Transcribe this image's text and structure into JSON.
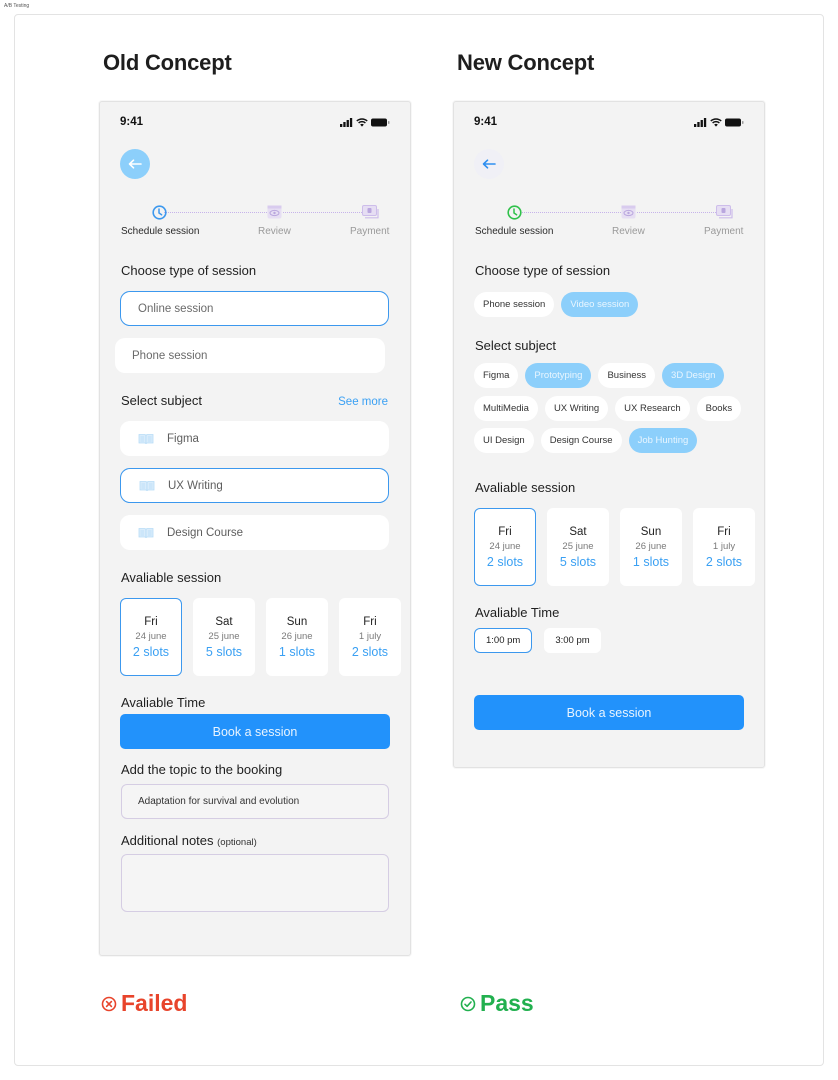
{
  "canvas": {
    "label": "A/B Testing"
  },
  "colors": {
    "accent_blue": "#2292fb",
    "light_blue": "#8ccffb",
    "failed_red": "#e8442b",
    "pass_green": "#22b04f",
    "step_active_old": "#3c98ee",
    "step_active_new": "#2fc14a"
  },
  "old_concept": {
    "title": "Old Concept",
    "status_time": "9:41",
    "back_icon": "arrow-left-icon",
    "stepper": [
      {
        "label": "Schedule session",
        "icon": "clock-icon",
        "active": true
      },
      {
        "label": "Review",
        "icon": "eye-icon",
        "active": false
      },
      {
        "label": "Payment",
        "icon": "cash-icon",
        "active": false
      }
    ],
    "session_type": {
      "title": "Choose type of session",
      "options": [
        {
          "label": "Online session",
          "selected": true
        },
        {
          "label": "Phone session",
          "selected": false
        }
      ]
    },
    "subject": {
      "title": "Select subject",
      "see_more": "See more",
      "options": [
        {
          "label": "Figma",
          "icon": "book-icon",
          "selected": false
        },
        {
          "label": "UX Writing",
          "icon": "book-icon",
          "selected": true
        },
        {
          "label": "Design Course",
          "icon": "book-icon",
          "selected": false
        }
      ]
    },
    "available_session": {
      "title": "Avaliable session",
      "dates": [
        {
          "day": "Fri",
          "date": "24 june",
          "slots": "2 slots",
          "selected": true
        },
        {
          "day": "Sat",
          "date": "25 june",
          "slots": "5 slots",
          "selected": false
        },
        {
          "day": "Sun",
          "date": "26 june",
          "slots": "1 slots",
          "selected": false
        },
        {
          "day": "Fri",
          "date": "1 july",
          "slots": "2 slots",
          "selected": false
        }
      ]
    },
    "available_time": {
      "title": "Avaliable Time"
    },
    "book_button": "Book a session",
    "topic": {
      "title": "Add the topic to the booking",
      "value": "Adaptation for survival and evolution"
    },
    "notes": {
      "title": "Additional notes",
      "optional": "(optional)",
      "value": ""
    },
    "result": {
      "label": "Failed",
      "icon": "x-circle-icon"
    }
  },
  "new_concept": {
    "title": "New Concept",
    "status_time": "9:41",
    "back_icon": "arrow-left-icon",
    "stepper": [
      {
        "label": "Schedule session",
        "icon": "clock-icon",
        "active": true
      },
      {
        "label": "Review",
        "icon": "eye-icon",
        "active": false
      },
      {
        "label": "Payment",
        "icon": "cash-icon",
        "active": false
      }
    ],
    "session_type": {
      "title": "Choose type of session",
      "options": [
        {
          "label": "Phone session",
          "selected": false
        },
        {
          "label": "Video session",
          "selected": true
        }
      ]
    },
    "subject": {
      "title": "Select subject",
      "rows": [
        [
          {
            "label": "Figma",
            "selected": false
          },
          {
            "label": "Prototyping",
            "selected": true
          },
          {
            "label": "Business",
            "selected": false
          },
          {
            "label": "3D Design",
            "selected": true
          }
        ],
        [
          {
            "label": "MultiMedia",
            "selected": false
          },
          {
            "label": "UX Writing",
            "selected": false
          },
          {
            "label": "UX Research",
            "selected": false
          },
          {
            "label": "Books",
            "selected": false
          }
        ],
        [
          {
            "label": "UI Design",
            "selected": false
          },
          {
            "label": "Design Course",
            "selected": false
          },
          {
            "label": "Job Hunting",
            "selected": true
          }
        ]
      ]
    },
    "available_session": {
      "title": "Avaliable session",
      "dates": [
        {
          "day": "Fri",
          "date": "24 june",
          "slots": "2 slots",
          "selected": true
        },
        {
          "day": "Sat",
          "date": "25 june",
          "slots": "5 slots",
          "selected": false
        },
        {
          "day": "Sun",
          "date": "26 june",
          "slots": "1 slots",
          "selected": false
        },
        {
          "day": "Fri",
          "date": "1 july",
          "slots": "2 slots",
          "selected": false
        }
      ]
    },
    "available_time": {
      "title": "Avaliable Time",
      "options": [
        {
          "label": "1:00 pm",
          "selected": true
        },
        {
          "label": "3:00 pm",
          "selected": false
        }
      ]
    },
    "book_button": "Book a session",
    "result": {
      "label": "Pass",
      "icon": "check-circle-icon"
    }
  }
}
